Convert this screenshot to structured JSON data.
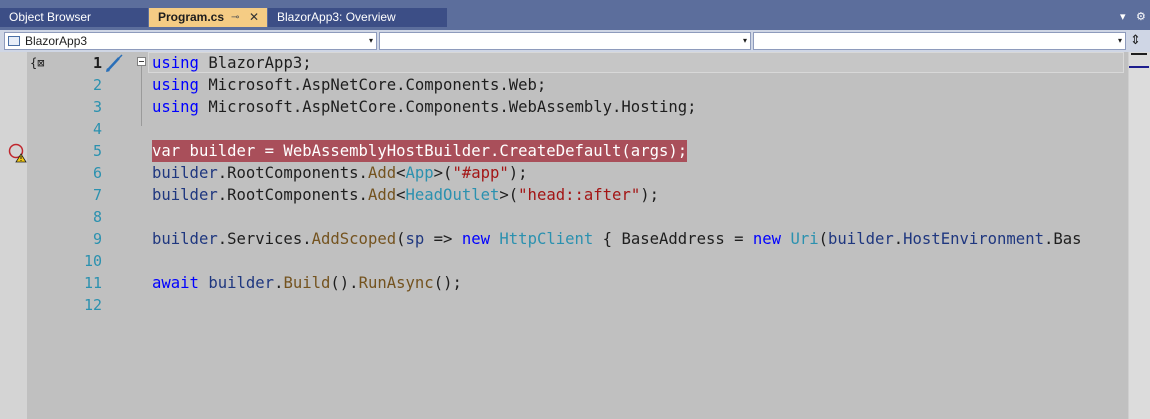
{
  "tabs": [
    {
      "label": "Object Browser",
      "active": false
    },
    {
      "label": "Program.cs",
      "active": true,
      "pin_glyph": "⊸",
      "close_glyph": "✕"
    },
    {
      "label": "BlazorApp3: Overview",
      "active": false
    }
  ],
  "tab_tools": {
    "dropdown_glyph": "▾",
    "settings_glyph": "⚙"
  },
  "navbar": {
    "project": "BlazorApp3",
    "type_combo": "",
    "member_combo": "",
    "caret_glyph": "▾",
    "split_glyph": "⇕"
  },
  "editor": {
    "context_glyph": "{⊠",
    "current_line": 1,
    "breakpoint_line": 5,
    "lines": [
      {
        "n": "1"
      },
      {
        "n": "2"
      },
      {
        "n": "3"
      },
      {
        "n": "4"
      },
      {
        "n": "5"
      },
      {
        "n": "6"
      },
      {
        "n": "7"
      },
      {
        "n": "8"
      },
      {
        "n": "9"
      },
      {
        "n": "10"
      },
      {
        "n": "11"
      },
      {
        "n": "12"
      }
    ],
    "tokens": {
      "l1": [
        "using",
        " BlazorApp3;"
      ],
      "l2": [
        "using",
        " Microsoft.AspNetCore.Components.Web;"
      ],
      "l3": [
        "using",
        " Microsoft.AspNetCore.Components.WebAssembly.Hosting;"
      ],
      "l5": "var builder = WebAssemblyHostBuilder.CreateDefault(args);",
      "l6": [
        "builder",
        ".RootComponents.",
        "Add",
        "<",
        "App",
        ">(",
        "\"#app\"",
        ");"
      ],
      "l7": [
        "builder",
        ".RootComponents.",
        "Add",
        "<",
        "HeadOutlet",
        ">(",
        "\"head::after\"",
        ");"
      ],
      "l9": [
        "builder",
        ".Services.",
        "AddScoped",
        "(",
        "sp",
        " => ",
        "new",
        " ",
        "HttpClient",
        " { BaseAddress = ",
        "new",
        " ",
        "Uri",
        "(",
        "builder",
        ".",
        "HostEnvironment",
        ".Bas"
      ],
      "l11": [
        "await",
        " ",
        "builder",
        ".",
        "Build",
        "().",
        "RunAsync",
        "();"
      ]
    }
  }
}
